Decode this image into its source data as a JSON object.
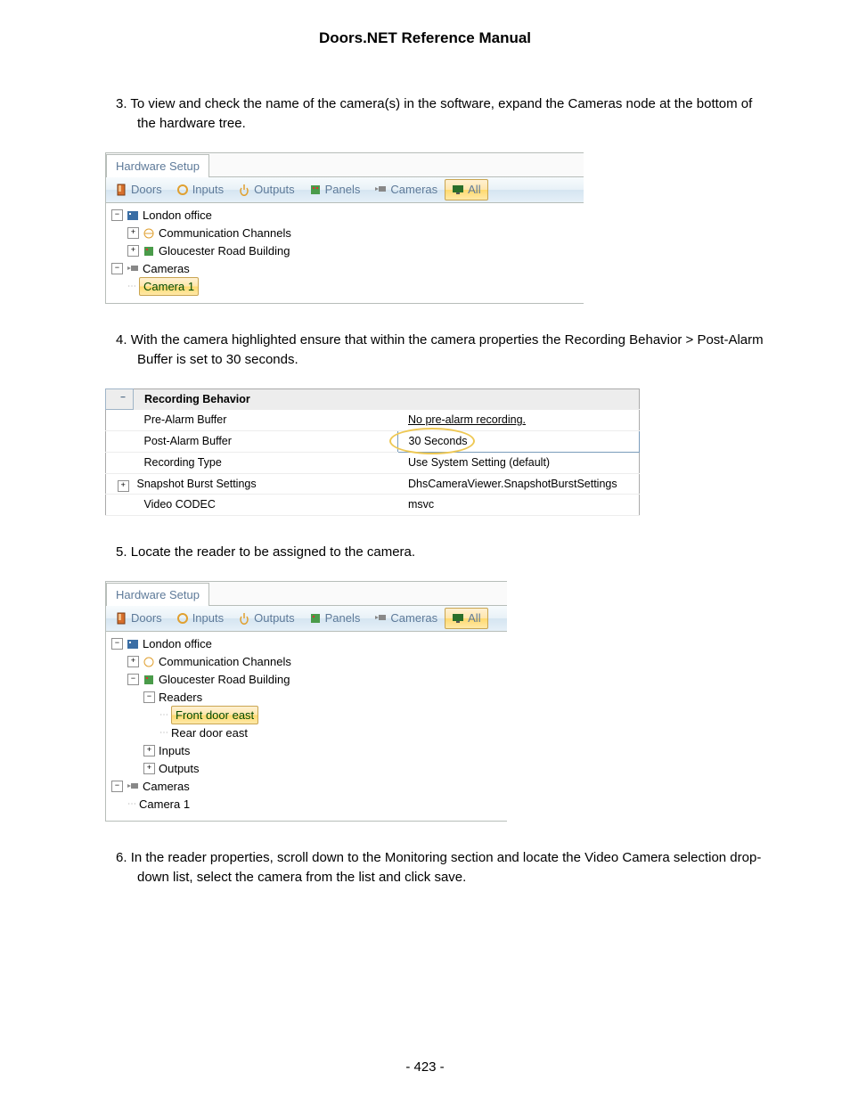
{
  "doc_title": "Doors.NET Reference Manual",
  "page_number": "- 423 -",
  "steps": {
    "s3": {
      "num": "3.",
      "text": "To view and check the name of the camera(s) in the software, expand the Cameras node at the bottom of the hardware tree."
    },
    "s4": {
      "num": "4.",
      "text": "With the camera highlighted ensure that within the camera properties the Recording Behavior > Post-Alarm Buffer is set to 30 seconds."
    },
    "s5": {
      "num": "5.",
      "text": "Locate the reader to be assigned to the camera."
    },
    "s6": {
      "num": "6.",
      "text": "In the reader properties, scroll down to the Monitoring section and locate the Video Camera selection drop-down list, select the camera from the list and click save."
    }
  },
  "panel_a": {
    "title": "Hardware Setup",
    "toolbar": [
      "Doors",
      "Inputs",
      "Outputs",
      "Panels",
      "Cameras",
      "All"
    ],
    "tree": {
      "london": "London office",
      "comm": "Communication Channels",
      "glou": "Gloucester Road Building",
      "cameras": "Cameras",
      "cam1": "Camera 1"
    }
  },
  "propgrid": {
    "header": "Recording Behavior",
    "rows": [
      {
        "label": "Pre-Alarm Buffer",
        "value": "No pre-alarm recording."
      },
      {
        "label": "Post-Alarm Buffer",
        "value": "30 Seconds"
      },
      {
        "label": "Recording Type",
        "value": "Use System Setting (default)"
      },
      {
        "label": "Snapshot Burst Settings",
        "value": "DhsCameraViewer.SnapshotBurstSettings"
      },
      {
        "label": "Video CODEC",
        "value": "msvc"
      }
    ]
  },
  "panel_b": {
    "title": "Hardware Setup",
    "toolbar": [
      "Doors",
      "Inputs",
      "Outputs",
      "Panels",
      "Cameras",
      "All"
    ],
    "tree": {
      "london": "London office",
      "comm": "Communication Channels",
      "glou": "Gloucester Road Building",
      "readers": "Readers",
      "front": "Front door east",
      "rear": "Rear door east",
      "inputs": "Inputs",
      "outputs": "Outputs",
      "cameras": "Cameras",
      "cam1": "Camera 1"
    }
  }
}
